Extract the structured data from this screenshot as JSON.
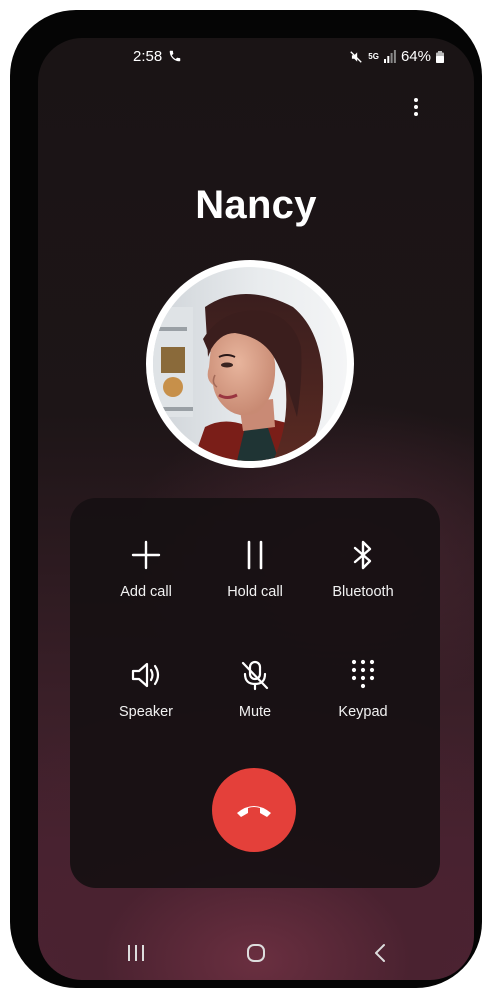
{
  "status_bar": {
    "time": "2:58",
    "network": "5G",
    "battery": "64%",
    "icons": [
      "phone-icon",
      "mute-icon",
      "signal-icon",
      "battery-icon"
    ]
  },
  "contact": {
    "name": "Nancy"
  },
  "controls": [
    {
      "id": "add-call",
      "label": "Add call",
      "icon": "plus-icon"
    },
    {
      "id": "hold-call",
      "label": "Hold call",
      "icon": "pause-icon"
    },
    {
      "id": "bluetooth",
      "label": "Bluetooth",
      "icon": "bluetooth-icon"
    },
    {
      "id": "speaker",
      "label": "Speaker",
      "icon": "speaker-icon"
    },
    {
      "id": "mute",
      "label": "Mute",
      "icon": "mic-off-icon"
    },
    {
      "id": "keypad",
      "label": "Keypad",
      "icon": "dialpad-icon"
    }
  ],
  "end_call": {
    "icon": "end-call-icon",
    "color": "#e4403a"
  },
  "nav": [
    "recent-apps-icon",
    "home-icon",
    "back-icon"
  ],
  "colors": {
    "panel": "#161012",
    "end_call": "#e4403a",
    "text": "#ffffff"
  }
}
